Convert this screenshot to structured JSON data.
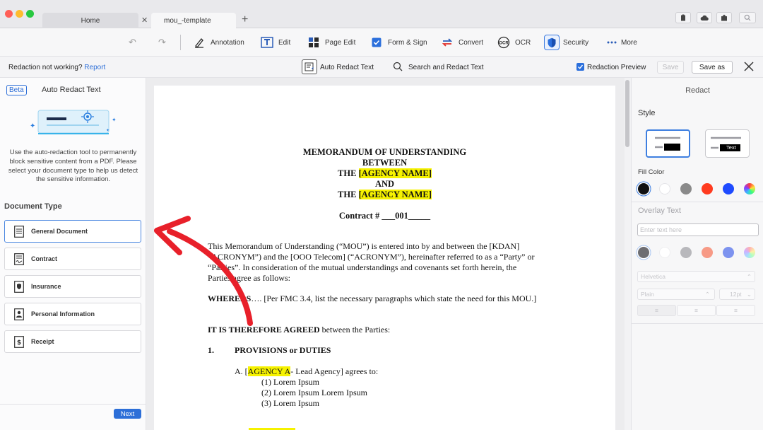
{
  "window": {
    "tabs": [
      {
        "label": "Home"
      },
      {
        "label": "mou_-template"
      }
    ],
    "traffic_colors": [
      "#ff5f57",
      "#febc2e",
      "#28c840"
    ]
  },
  "toolbar": {
    "items": [
      {
        "label": "Annotation",
        "icon": "pen-icon"
      },
      {
        "label": "Edit",
        "icon": "edit-icon"
      },
      {
        "label": "Page Edit",
        "icon": "grid-icon"
      },
      {
        "label": "Form & Sign",
        "icon": "checkbox-icon"
      },
      {
        "label": "Convert",
        "icon": "convert-icon"
      },
      {
        "label": "OCR",
        "icon": "ocr-icon"
      },
      {
        "label": "Security",
        "icon": "shield-icon"
      },
      {
        "label": "More",
        "icon": "dots-icon"
      }
    ]
  },
  "redaction_bar": {
    "message": "Redaction not working?",
    "report_link": "Report",
    "auto_redact": "Auto Redact Text",
    "search_redact": "Search and Redact Text",
    "preview_label": "Redaction Preview",
    "preview_checked": true,
    "save": "Save",
    "save_as": "Save as"
  },
  "left_panel": {
    "beta": "Beta",
    "title": "Auto Redact Text",
    "description": "Use the auto-redaction tool to permanently block sensitive content from a PDF. Please select your document type to help us detect the sensitive information.",
    "section_title": "Document Type",
    "doc_types": [
      {
        "label": "General Document",
        "icon": "document-lines-icon",
        "selected": true
      },
      {
        "label": "Contract",
        "icon": "contract-icon",
        "selected": false
      },
      {
        "label": "Insurance",
        "icon": "insurance-icon",
        "selected": false
      },
      {
        "label": "Personal Information",
        "icon": "person-card-icon",
        "selected": false
      },
      {
        "label": "Receipt",
        "icon": "receipt-dollar-icon",
        "selected": false
      }
    ],
    "next": "Next"
  },
  "document": {
    "title_lines": [
      "MEMORANDUM OF UNDERSTANDING",
      "BETWEEN"
    ],
    "the_prefix": "THE",
    "agency_placeholder": "[AGENCY NAME]",
    "and": "AND",
    "contract_line": "Contract # ___001_____",
    "intro_line1": "This Memorandum of Understanding (“MOU”) is entered into by and between the [KDAN]",
    "intro_line2": "“ACRONYM”) and the [OOO Telecom] (“ACRONYM”), hereinafter referred to as a “Party” or",
    "intro_line3": "“Parties”. In consideration of the mutual understandings and covenants set forth herein, the",
    "intro_line4": "Parties agree as follows:",
    "whereas_bold": "WHEREAS",
    "whereas_rest": "…. [Per FMC 3.4, list the necessary paragraphs which state the need for this MOU.]",
    "agreed_bold": "IT IS THEREFORE AGREED",
    "agreed_rest": " between the Parties:",
    "section_num": "1.",
    "section_title": "PROVISIONS or DUTIES",
    "agency_a_prefix": "A. [",
    "agency_a": "AGENCY A",
    "agency_a_rest": "- Lead Agency] agrees to:",
    "list": [
      "(1) Lorem Ipsum",
      "(2) Lorem Ipsum Lorem Ipsum",
      "(3) Lorem Ipsum"
    ],
    "highlight_color": "#f6f200",
    "arrow_color": "#e8202a"
  },
  "right_panel": {
    "title": "Redact",
    "style_label": "Style",
    "style_text_sample": "Text",
    "fill_color_label": "Fill Color",
    "fill_colors": [
      "#111111",
      "#ffffff",
      "#8a8a8a",
      "#ff3b1f",
      "#1f4bff",
      "rainbow"
    ],
    "overlay_label": "Overlay Text",
    "overlay_placeholder": "Enter text here",
    "overlay_colors": [
      "#6e6e72",
      "#ffffff",
      "#b8b8bc",
      "#f79a86",
      "#7d93ef",
      "rainbow"
    ],
    "font": "Helvetica",
    "font_style": "Plain",
    "font_size": "12pt"
  }
}
